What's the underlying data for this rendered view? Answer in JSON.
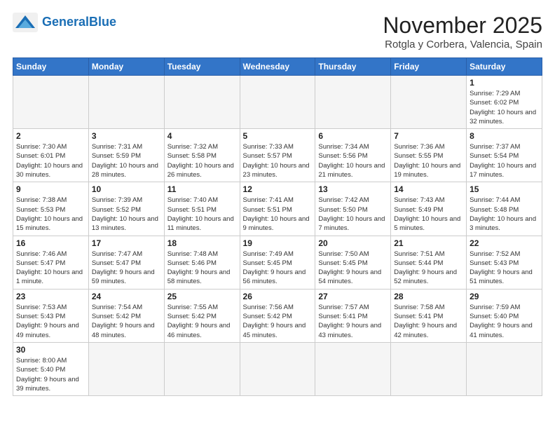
{
  "logo": {
    "text_general": "General",
    "text_blue": "Blue"
  },
  "header": {
    "month": "November 2025",
    "location": "Rotgla y Corbera, Valencia, Spain"
  },
  "weekdays": [
    "Sunday",
    "Monday",
    "Tuesday",
    "Wednesday",
    "Thursday",
    "Friday",
    "Saturday"
  ],
  "weeks": [
    [
      {
        "day": null,
        "info": null
      },
      {
        "day": null,
        "info": null
      },
      {
        "day": null,
        "info": null
      },
      {
        "day": null,
        "info": null
      },
      {
        "day": null,
        "info": null
      },
      {
        "day": null,
        "info": null
      },
      {
        "day": "1",
        "info": "Sunrise: 7:29 AM\nSunset: 6:02 PM\nDaylight: 10 hours and 32 minutes."
      }
    ],
    [
      {
        "day": "2",
        "info": "Sunrise: 7:30 AM\nSunset: 6:01 PM\nDaylight: 10 hours and 30 minutes."
      },
      {
        "day": "3",
        "info": "Sunrise: 7:31 AM\nSunset: 5:59 PM\nDaylight: 10 hours and 28 minutes."
      },
      {
        "day": "4",
        "info": "Sunrise: 7:32 AM\nSunset: 5:58 PM\nDaylight: 10 hours and 26 minutes."
      },
      {
        "day": "5",
        "info": "Sunrise: 7:33 AM\nSunset: 5:57 PM\nDaylight: 10 hours and 23 minutes."
      },
      {
        "day": "6",
        "info": "Sunrise: 7:34 AM\nSunset: 5:56 PM\nDaylight: 10 hours and 21 minutes."
      },
      {
        "day": "7",
        "info": "Sunrise: 7:36 AM\nSunset: 5:55 PM\nDaylight: 10 hours and 19 minutes."
      },
      {
        "day": "8",
        "info": "Sunrise: 7:37 AM\nSunset: 5:54 PM\nDaylight: 10 hours and 17 minutes."
      }
    ],
    [
      {
        "day": "9",
        "info": "Sunrise: 7:38 AM\nSunset: 5:53 PM\nDaylight: 10 hours and 15 minutes."
      },
      {
        "day": "10",
        "info": "Sunrise: 7:39 AM\nSunset: 5:52 PM\nDaylight: 10 hours and 13 minutes."
      },
      {
        "day": "11",
        "info": "Sunrise: 7:40 AM\nSunset: 5:51 PM\nDaylight: 10 hours and 11 minutes."
      },
      {
        "day": "12",
        "info": "Sunrise: 7:41 AM\nSunset: 5:51 PM\nDaylight: 10 hours and 9 minutes."
      },
      {
        "day": "13",
        "info": "Sunrise: 7:42 AM\nSunset: 5:50 PM\nDaylight: 10 hours and 7 minutes."
      },
      {
        "day": "14",
        "info": "Sunrise: 7:43 AM\nSunset: 5:49 PM\nDaylight: 10 hours and 5 minutes."
      },
      {
        "day": "15",
        "info": "Sunrise: 7:44 AM\nSunset: 5:48 PM\nDaylight: 10 hours and 3 minutes."
      }
    ],
    [
      {
        "day": "16",
        "info": "Sunrise: 7:46 AM\nSunset: 5:47 PM\nDaylight: 10 hours and 1 minute."
      },
      {
        "day": "17",
        "info": "Sunrise: 7:47 AM\nSunset: 5:47 PM\nDaylight: 9 hours and 59 minutes."
      },
      {
        "day": "18",
        "info": "Sunrise: 7:48 AM\nSunset: 5:46 PM\nDaylight: 9 hours and 58 minutes."
      },
      {
        "day": "19",
        "info": "Sunrise: 7:49 AM\nSunset: 5:45 PM\nDaylight: 9 hours and 56 minutes."
      },
      {
        "day": "20",
        "info": "Sunrise: 7:50 AM\nSunset: 5:45 PM\nDaylight: 9 hours and 54 minutes."
      },
      {
        "day": "21",
        "info": "Sunrise: 7:51 AM\nSunset: 5:44 PM\nDaylight: 9 hours and 52 minutes."
      },
      {
        "day": "22",
        "info": "Sunrise: 7:52 AM\nSunset: 5:43 PM\nDaylight: 9 hours and 51 minutes."
      }
    ],
    [
      {
        "day": "23",
        "info": "Sunrise: 7:53 AM\nSunset: 5:43 PM\nDaylight: 9 hours and 49 minutes."
      },
      {
        "day": "24",
        "info": "Sunrise: 7:54 AM\nSunset: 5:42 PM\nDaylight: 9 hours and 48 minutes."
      },
      {
        "day": "25",
        "info": "Sunrise: 7:55 AM\nSunset: 5:42 PM\nDaylight: 9 hours and 46 minutes."
      },
      {
        "day": "26",
        "info": "Sunrise: 7:56 AM\nSunset: 5:42 PM\nDaylight: 9 hours and 45 minutes."
      },
      {
        "day": "27",
        "info": "Sunrise: 7:57 AM\nSunset: 5:41 PM\nDaylight: 9 hours and 43 minutes."
      },
      {
        "day": "28",
        "info": "Sunrise: 7:58 AM\nSunset: 5:41 PM\nDaylight: 9 hours and 42 minutes."
      },
      {
        "day": "29",
        "info": "Sunrise: 7:59 AM\nSunset: 5:40 PM\nDaylight: 9 hours and 41 minutes."
      }
    ],
    [
      {
        "day": "30",
        "info": "Sunrise: 8:00 AM\nSunset: 5:40 PM\nDaylight: 9 hours and 39 minutes."
      },
      {
        "day": null,
        "info": null
      },
      {
        "day": null,
        "info": null
      },
      {
        "day": null,
        "info": null
      },
      {
        "day": null,
        "info": null
      },
      {
        "day": null,
        "info": null
      },
      {
        "day": null,
        "info": null
      }
    ]
  ]
}
